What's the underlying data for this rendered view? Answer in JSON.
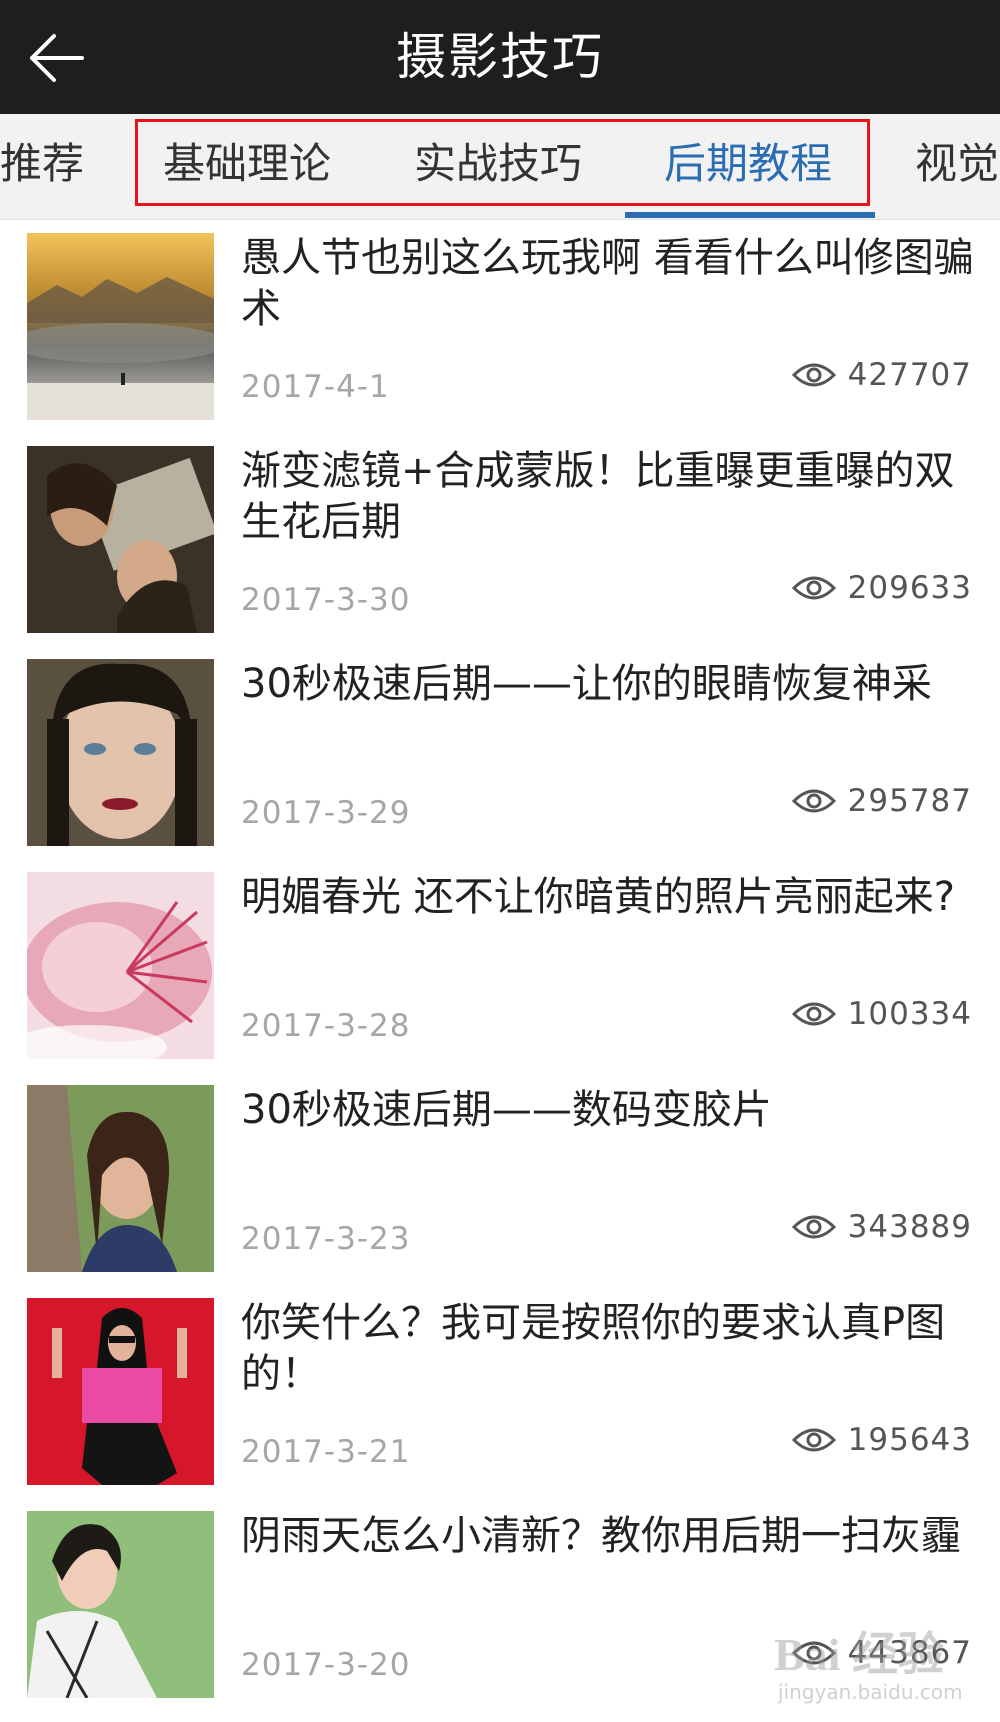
{
  "header": {
    "title": "摄影技巧",
    "back_icon": "arrow-left-icon"
  },
  "tabs": [
    {
      "label": "推荐",
      "active": false
    },
    {
      "label": "基础理论",
      "active": false
    },
    {
      "label": "实战技巧",
      "active": false
    },
    {
      "label": "后期教程",
      "active": true
    },
    {
      "label": "视觉",
      "active": false
    }
  ],
  "colors": {
    "header_bg": "#1e1e1e",
    "tab_bg": "#f2f2f2",
    "accent": "#2a6db3",
    "highlight": "#e8141c"
  },
  "articles": [
    {
      "title": "愚人节也别这么玩我啊 看看什么叫修图骗术",
      "date": "2017-4-1",
      "views": "427707",
      "thumb": "mountain-landscape"
    },
    {
      "title": "渐变滤镜+合成蒙版！比重曝更重曝的双生花后期",
      "date": "2017-3-30",
      "views": "209633",
      "thumb": "double-portrait"
    },
    {
      "title": "30秒极速后期——让你的眼睛恢复神采",
      "date": "2017-3-29",
      "views": "295787",
      "thumb": "woman-portrait"
    },
    {
      "title": "明媚春光 还不让你暗黄的照片亮丽起来?",
      "date": "2017-3-28",
      "views": "100334",
      "thumb": "pink-flower"
    },
    {
      "title": "30秒极速后期——数码变胶片",
      "date": "2017-3-23",
      "views": "343889",
      "thumb": "girl-by-tree"
    },
    {
      "title": "你笑什么？我可是按照你的要求认真P图的！",
      "date": "2017-3-21",
      "views": "195643",
      "thumb": "woman-red-wall"
    },
    {
      "title": "阴雨天怎么小清新？教你用后期一扫灰霾",
      "date": "2017-3-20",
      "views": "443867",
      "thumb": "girl-green-field"
    }
  ],
  "watermark": {
    "main": "Bai 经验",
    "sub": "jingyan.baidu.com"
  }
}
